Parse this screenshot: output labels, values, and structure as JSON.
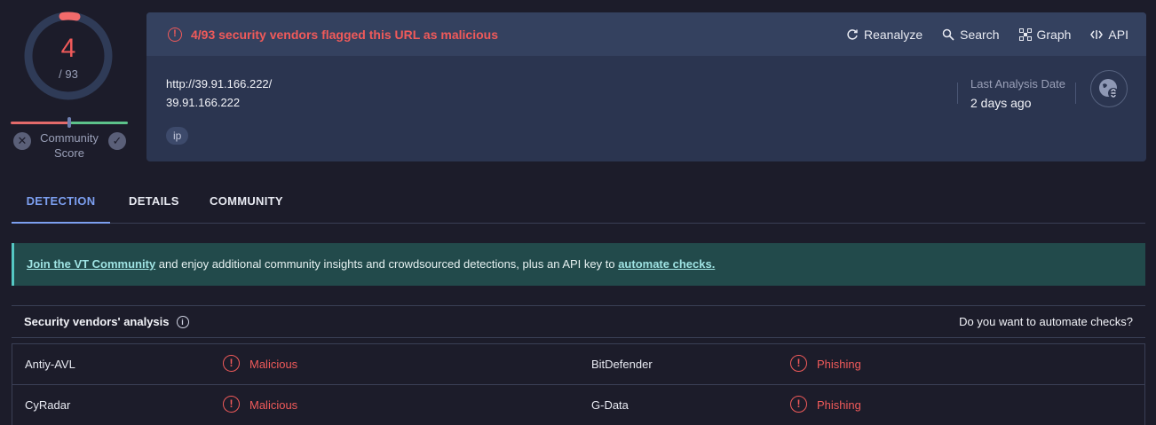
{
  "score": {
    "detected": "4",
    "total": "/ 93",
    "community_label": "Community Score"
  },
  "header": {
    "alert": "4/93 security vendors flagged this URL as malicious",
    "actions": [
      {
        "label": "Reanalyze",
        "icon": "refresh-icon"
      },
      {
        "label": "Search",
        "icon": "search-icon"
      },
      {
        "label": "Graph",
        "icon": "graph-icon"
      },
      {
        "label": "API",
        "icon": "api-icon"
      }
    ]
  },
  "target": {
    "url": "http://39.91.166.222/",
    "host": "39.91.166.222",
    "tag": "ip",
    "last_analysis_label": "Last Analysis Date",
    "last_analysis_value": "2 days ago"
  },
  "tabs": [
    {
      "label": "DETECTION",
      "active": true
    },
    {
      "label": "DETAILS",
      "active": false
    },
    {
      "label": "COMMUNITY",
      "active": false
    }
  ],
  "banner": {
    "link1": "Join the VT Community",
    "middle": " and enjoy additional community insights and crowdsourced detections, plus an API key to ",
    "link2": "automate checks."
  },
  "vendors": {
    "title": "Security vendors' analysis",
    "automate_q": "Do you want to automate checks?",
    "rows": [
      {
        "left_name": "Antiy-AVL",
        "left_result": "Malicious",
        "right_name": "BitDefender",
        "right_result": "Phishing"
      },
      {
        "left_name": "CyRadar",
        "left_result": "Malicious",
        "right_name": "G-Data",
        "right_result": "Phishing"
      }
    ]
  },
  "colors": {
    "alert": "#f05a5a",
    "accent": "#7c9ff0",
    "banner_bg": "#224a4b"
  }
}
